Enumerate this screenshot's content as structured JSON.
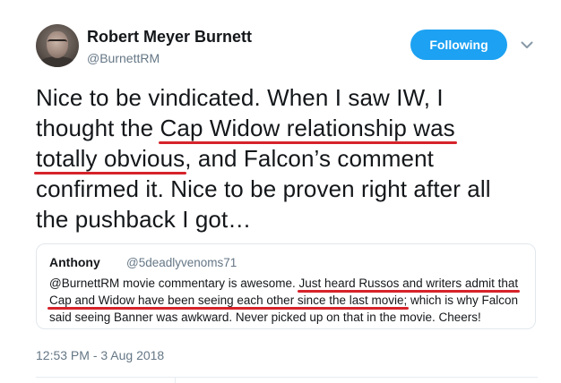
{
  "author": {
    "display_name": "Robert Meyer Burnett",
    "handle": "@BurnettRM"
  },
  "follow_button": {
    "label": "Following",
    "color": "#1da1f2"
  },
  "tweet": {
    "lines": [
      "Nice to be vindicated. When I saw IW, I",
      "thought the ",
      "Cap Widow relationship was",
      "totally obvious",
      ", and Falcon’s comment",
      "confirmed it. Nice to be proven right after all",
      "the pushback I got…"
    ]
  },
  "quoted": {
    "name": "Anthony",
    "handle": "@5deadlyvenoms71",
    "line1_a": "@BurnettRM movie commentary is awesome. ",
    "line1_b": "Just heard Russos and writers admit that",
    "line2_a": "Cap and Widow have been seeing each other since the last movie;",
    "line2_b": " which is why Falcon",
    "line3": "said seeing Banner was awkward. Never picked up on that in the movie. Cheers!"
  },
  "timestamp": "12:53 PM - 3 Aug 2018",
  "annotation_color": "#d6232b"
}
